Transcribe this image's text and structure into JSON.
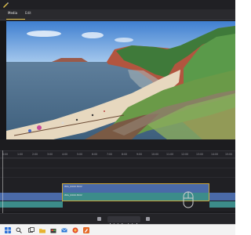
{
  "menubar": {
    "items": [
      "Media",
      "Edit"
    ]
  },
  "ruler": {
    "ticks": [
      "0:00",
      "1:00",
      "2:00",
      "3:00",
      "4:00",
      "5:00",
      "6:00",
      "7:00",
      "8:00",
      "9:00",
      "10:00",
      "11:00",
      "12:00",
      "13:00",
      "14:00",
      "15:00"
    ]
  },
  "tracks": {
    "clip_label_top": "IMG_0000.MOV",
    "clip_label_bottom": "IMG_0000.MOV"
  },
  "colors": {
    "accent": "#e2c24a",
    "selection": "#c9a53a",
    "clip_blue": "#4a6aa8",
    "clip_teal": "#3c8c8a",
    "background": "#1c1c1f"
  },
  "taskbar": {
    "icons": [
      "start-icon",
      "search-icon",
      "task-view-icon",
      "file-explorer-icon",
      "store-icon",
      "mail-icon",
      "browser-icon",
      "editor-app-icon"
    ]
  }
}
